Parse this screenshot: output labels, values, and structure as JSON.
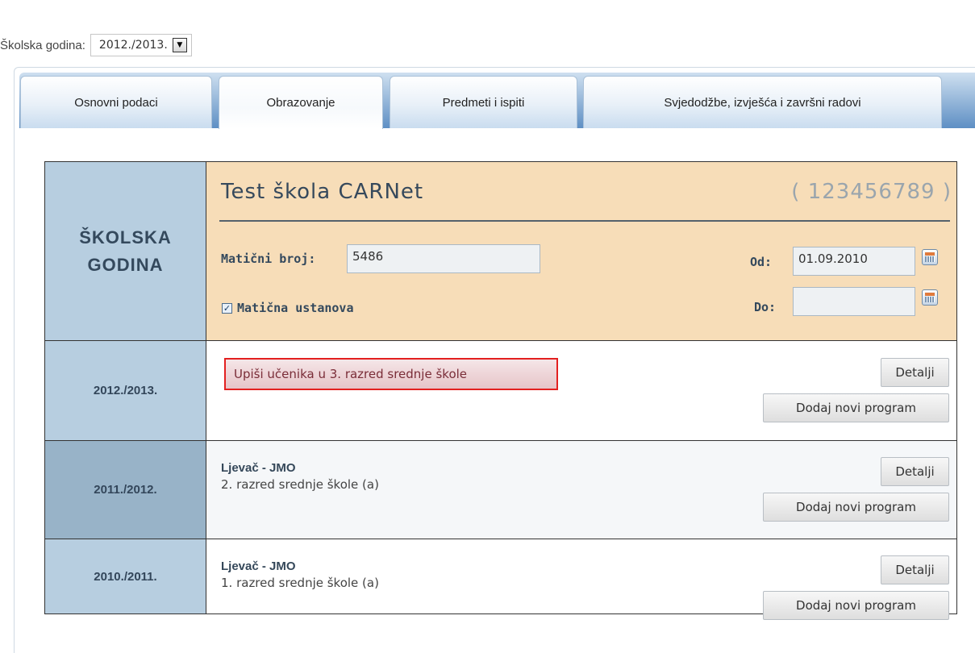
{
  "year_selector": {
    "label": "Školska godina:",
    "value": "2012./2013."
  },
  "tabs": [
    {
      "label": "Osnovni podaci",
      "active": false
    },
    {
      "label": "Obrazovanje",
      "active": true
    },
    {
      "label": "Predmeti i ispiti",
      "active": false
    },
    {
      "label": "Svjedodžbe, izvješća i završni radovi",
      "active": false
    }
  ],
  "header": {
    "left_line1": "ŠKOLSKA",
    "left_line2": "GODINA",
    "school_name": "Test škola CARNet",
    "school_code": "( 123456789 )",
    "maticni_label": "Matični broj:",
    "maticni_value": "5486",
    "maticna_label": "Matična ustanova",
    "maticna_checked": true,
    "od_label": "Od:",
    "od_value": "01.09.2010",
    "do_label": "Do:",
    "do_value": ""
  },
  "years": [
    {
      "year": "2012./2013.",
      "enroll_label": "Upiši učenika u 3. razred srednje škole",
      "details_label": "Detalji",
      "add_label": "Dodaj novi program"
    },
    {
      "year": "2011./2012.",
      "program": "Ljevač - JMO",
      "class": "2. razred srednje škole (a)",
      "details_label": "Detalji",
      "add_label": "Dodaj novi program"
    },
    {
      "year": "2010./2011.",
      "program": "Ljevač - JMO",
      "class": "1. razred srednje škole (a)",
      "details_label": "Detalji",
      "add_label": "Dodaj novi program"
    }
  ],
  "colors": {
    "header_left_bg": "#b7cee0",
    "header_right_bg": "#f7ddb8",
    "enroll_border": "#e32020",
    "tabbar_gradient_end": "#5e8fc4"
  }
}
